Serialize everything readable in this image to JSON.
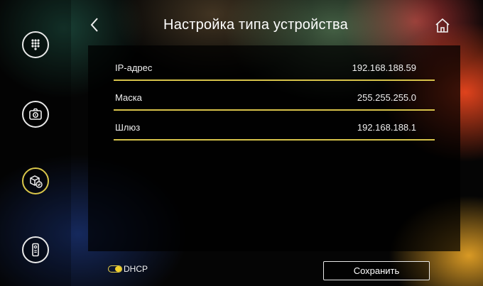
{
  "header": {
    "title": "Настройка типа устройства",
    "back_icon": "chevron-left-icon",
    "home_icon": "home-icon"
  },
  "sidebar": {
    "items": [
      {
        "icon": "keypad-icon",
        "active": false
      },
      {
        "icon": "camera-settings-icon",
        "active": false
      },
      {
        "icon": "device-type-icon",
        "active": true
      },
      {
        "icon": "outdoor-station-icon",
        "active": false
      }
    ]
  },
  "network": {
    "fields": [
      {
        "label": "IP-адрес",
        "value": "192.168.188.59"
      },
      {
        "label": "Маска",
        "value": "255.255.255.0"
      },
      {
        "label": "Шлюз",
        "value": "192.168.188.1"
      }
    ]
  },
  "dhcp": {
    "label": "DHCP",
    "enabled": true
  },
  "footer": {
    "save_label": "Сохранить"
  },
  "colors": {
    "accent": "#d6c24a",
    "toggle": "#f4d22a",
    "text": "#f0f0f0"
  }
}
